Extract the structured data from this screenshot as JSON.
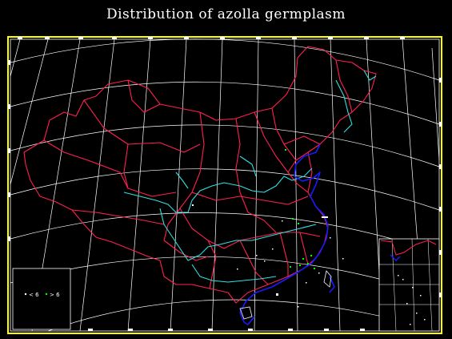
{
  "title": "Distribution of azolla germplasm",
  "legend": {
    "item1_label": "< 6",
    "item2_label": "> 6",
    "item1_color": "#ffffff",
    "item2_color": "#00ff00"
  },
  "colors": {
    "background": "#000000",
    "frame": "#ffff00",
    "graticule": "#ffffff",
    "province_borders": "#ff2050",
    "rivers": "#30e0e0",
    "coastline": "#1a1aff",
    "site_low": "#ffffff",
    "site_high": "#00ff00"
  },
  "inset": "South China Sea islands"
}
